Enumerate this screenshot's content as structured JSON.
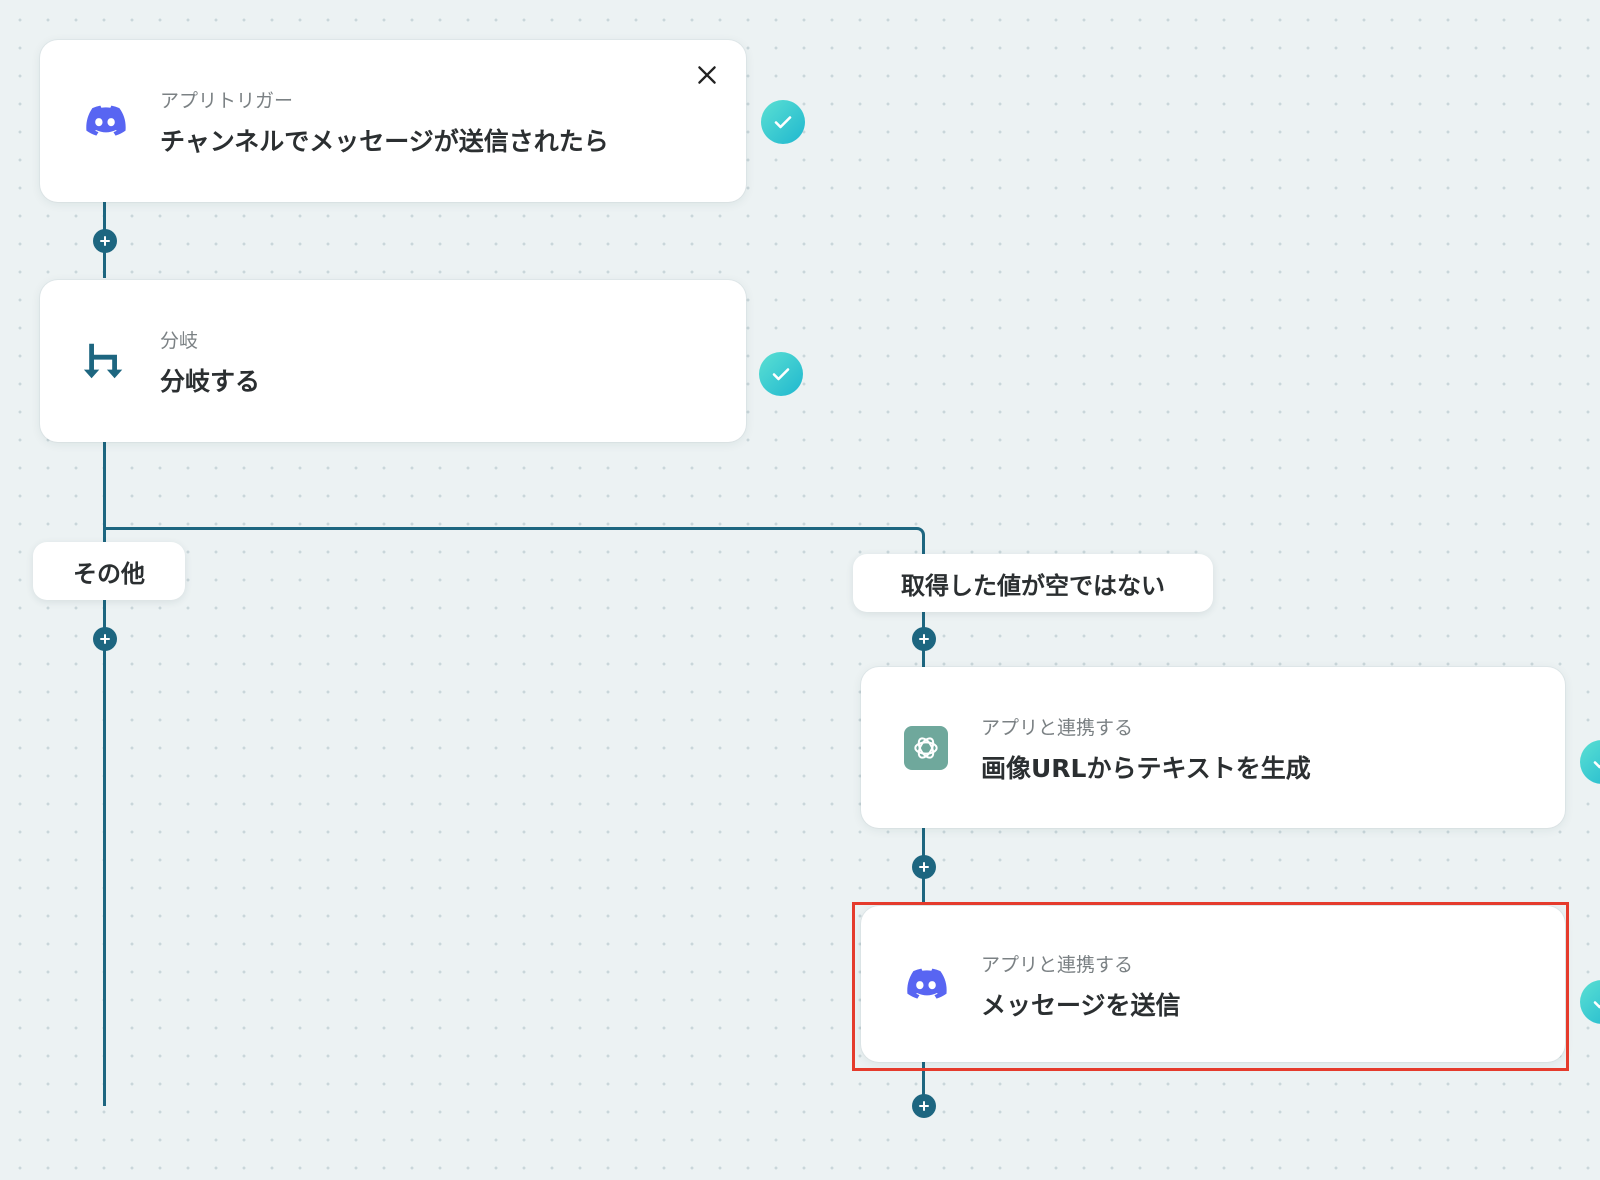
{
  "flow": {
    "trigger": {
      "sub": "アプリトリガー",
      "title": "チャンネルでメッセージが送信されたら",
      "icon": "discord-icon"
    },
    "branch": {
      "sub": "分岐",
      "title": "分岐する",
      "icon": "branch-icon"
    },
    "branch_labels": {
      "other": "その他",
      "condition": "取得した値が空ではない"
    },
    "step_ai": {
      "sub": "アプリと連携する",
      "title": "画像URLからテキストを生成",
      "icon": "openai-icon"
    },
    "step_send": {
      "sub": "アプリと連携する",
      "title": "メッセージを送信",
      "icon": "discord-icon"
    }
  },
  "colors": {
    "connector": "#1d6680",
    "check": "#2cc5d0",
    "discord": "#5865f2",
    "openai": "#6fa89c",
    "highlight": "#e53b2c"
  }
}
